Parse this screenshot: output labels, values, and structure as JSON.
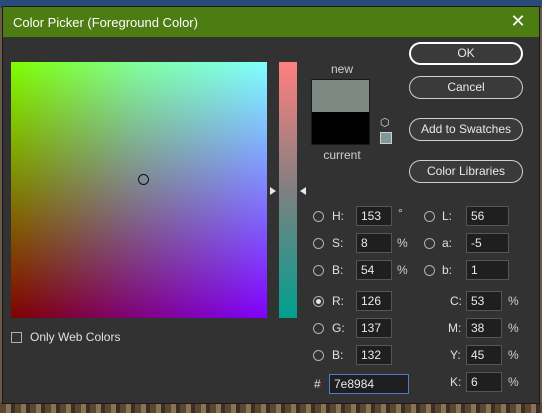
{
  "window": {
    "title": "Color Picker (Foreground Color)",
    "close_glyph": "✕"
  },
  "colors": {
    "new": "#7e8984",
    "current": "#000000",
    "titlebar": "#4c7c12",
    "websafe": "#7e9999"
  },
  "preview": {
    "new_label": "new",
    "current_label": "current"
  },
  "buttons": {
    "ok": "OK",
    "cancel": "Cancel",
    "add_to_swatches": "Add to Swatches",
    "color_libraries": "Color Libraries"
  },
  "hsb": {
    "h": {
      "label": "H:",
      "value": "153",
      "unit": "°"
    },
    "s": {
      "label": "S:",
      "value": "8",
      "unit": "%"
    },
    "b": {
      "label": "B:",
      "value": "54",
      "unit": "%"
    }
  },
  "rgb": {
    "r": {
      "label": "R:",
      "value": "126",
      "selected": true
    },
    "g": {
      "label": "G:",
      "value": "137"
    },
    "b": {
      "label": "B:",
      "value": "132"
    }
  },
  "lab": {
    "l": {
      "label": "L:",
      "value": "56"
    },
    "a": {
      "label": "a:",
      "value": "-5"
    },
    "b": {
      "label": "b:",
      "value": "1"
    }
  },
  "cmyk": {
    "c": {
      "label": "C:",
      "value": "53",
      "unit": "%"
    },
    "m": {
      "label": "M:",
      "value": "38",
      "unit": "%"
    },
    "y": {
      "label": "Y:",
      "value": "45",
      "unit": "%"
    },
    "k": {
      "label": "K:",
      "value": "6",
      "unit": "%"
    }
  },
  "hex": {
    "label": "#",
    "value": "7e8984"
  },
  "only_web_colors": {
    "label": "Only Web Colors",
    "checked": false
  },
  "icons": {
    "cube": "cube-icon",
    "cube_glyph": "⬡"
  }
}
